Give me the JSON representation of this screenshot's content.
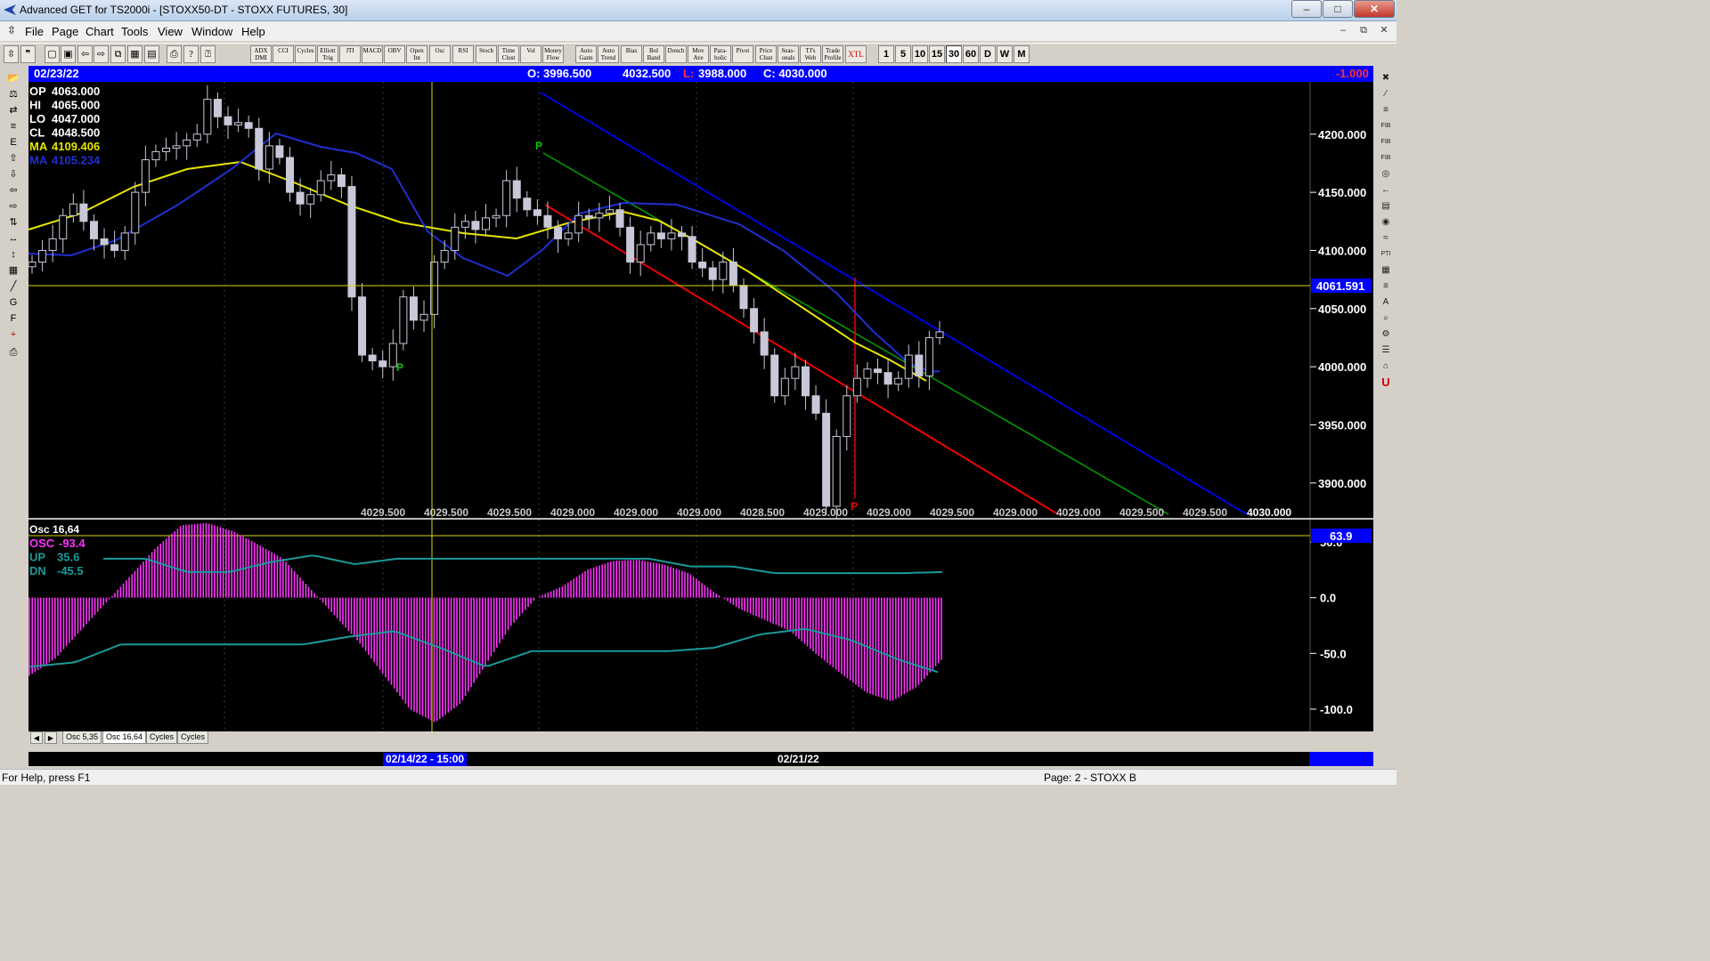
{
  "window": {
    "title": "Advanced GET for TS2000i - [STOXX50-DT - STOXX FUTURES, 30]",
    "buttons": [
      "–",
      "□",
      "✕"
    ]
  },
  "menu": [
    "File",
    "Page",
    "Chart",
    "Tools",
    "View",
    "Window",
    "Help"
  ],
  "mdi_buttons": [
    "–",
    "⧉",
    "✕"
  ],
  "toolbar": {
    "indicators": [
      "ADX DMI",
      "CCI",
      "Cycles",
      "Elliott Trig",
      "JTI",
      "MACD",
      "OBV",
      "Open Int",
      "Osc",
      "RSI",
      "Stoch",
      "Time Clust",
      "Vol",
      "Money Flow",
      "Auto Gann",
      "Auto Trend",
      "Bias",
      "Bol Band",
      "Donch",
      "Mov Ave",
      "Para-bolic",
      "Pivot",
      "Price Clust",
      "Seas-onals",
      "TJ's Web",
      "Trade Profile",
      "XTL"
    ],
    "timeframes": [
      "1",
      "5",
      "10",
      "15",
      "30",
      "60",
      "D",
      "W",
      "M"
    ],
    "active_timeframe": "30"
  },
  "left_tools": [
    "📂",
    "⚖",
    "⇄",
    "≡",
    "E",
    "⇧",
    "⇩",
    "⇦",
    "⇨",
    "⇅",
    "↔",
    "↕",
    "▦",
    "╱",
    "G",
    "F",
    "+",
    "⎙"
  ],
  "right_tools": [
    "✖",
    "∕",
    "≡",
    "FIB",
    "FIB",
    "FIB",
    "◎",
    "←",
    "▤",
    "◉",
    "≈",
    "PTI",
    "▦",
    "≡",
    "A",
    "⌕",
    "⚙",
    "☰",
    "⌂",
    "U"
  ],
  "info": {
    "date": "02/23/22",
    "open": "O: 3996.500",
    "high": "4032.500",
    "low_label": "L:",
    "low": "3988.000",
    "close": "C: 4030.000",
    "change": "-1.000"
  },
  "legend": {
    "op_label": "OP",
    "op": "4063.000",
    "hi_label": "HI",
    "hi": "4065.000",
    "lo_label": "LO",
    "lo": "4047.000",
    "cl_label": "CL",
    "cl": "4048.500",
    "ma1_label": "MA",
    "ma1": "4109.406",
    "ma2_label": "MA",
    "ma2": "4105.234"
  },
  "colors": {
    "background": "#000000",
    "bars": "#c8c8d8",
    "ma1": "#e6e600",
    "ma2": "#1f2fd0",
    "channel_top": "#0000dd",
    "channel_mid": "#00a000",
    "channel_bottom": "#ee0000",
    "osc": "#ff33ff",
    "bands": "#1a9a9a",
    "crosshair": "#d8d800",
    "accent": "#0000ff"
  },
  "chart_data": [
    {
      "type": "candlestick",
      "title": "STOXX50-DT - STOXX FUTURES, 30",
      "y_ticks": [
        "4200.000",
        "4150.000",
        "4100.000",
        "4050.000",
        "4000.000",
        "3950.000",
        "3900.000"
      ],
      "ylim": [
        3870,
        4245
      ],
      "cursor_price": "4061.591",
      "bottom_labels": [
        "4029.500",
        "4029.500",
        "4029.500",
        "4029.000",
        "4029.000",
        "4029.000",
        "4028.500",
        "4029.000",
        "4029.000",
        "4029.500",
        "4029.000",
        "4029.000",
        "4029.500",
        "4029.500"
      ],
      "last_price": "4030.000",
      "pivot_label": "P",
      "x_dates": [
        "02/14/22 - 15:00",
        "02/21/22"
      ],
      "closes": [
        4090,
        4100,
        4110,
        4130,
        4140,
        4125,
        4110,
        4105,
        4100,
        4115,
        4150,
        4178,
        4185,
        4188,
        4190,
        4195,
        4200,
        4230,
        4215,
        4208,
        4210,
        4205,
        4170,
        4190,
        4180,
        4150,
        4140,
        4148,
        4160,
        4165,
        4155,
        4060,
        4010,
        4005,
        4000,
        4020,
        4060,
        4040,
        4045,
        4090,
        4100,
        4120,
        4125,
        4118,
        4128,
        4130,
        4160,
        4145,
        4135,
        4130,
        4120,
        4110,
        4115,
        4130,
        4128,
        4132,
        4135,
        4120,
        4090,
        4105,
        4115,
        4110,
        4115,
        4112,
        4090,
        4085,
        4075,
        4090,
        4070,
        4050,
        4030,
        4010,
        3975,
        3990,
        4000,
        3975,
        3960,
        3880,
        3940,
        3975,
        3990,
        3998,
        3995,
        3985,
        3990,
        4010,
        3992,
        4025,
        4030
      ]
    },
    {
      "type": "bar",
      "title": "Osc 16,64",
      "series": [
        {
          "name": "OSC",
          "label": "OSC",
          "value": "-93.4"
        },
        {
          "name": "UP",
          "label": "UP",
          "value": "35.6"
        },
        {
          "name": "DN",
          "label": "DN",
          "value": "-45.5"
        }
      ],
      "y_ticks": [
        "50.0",
        "0.0",
        "-50.0",
        "-100.0"
      ],
      "ylim": [
        -120,
        70
      ],
      "cursor_value": "63.9",
      "values": [
        -70,
        -55,
        -30,
        -5,
        20,
        45,
        65,
        67,
        60,
        48,
        35,
        10,
        -15,
        -40,
        -70,
        -100,
        -112,
        -95,
        -60,
        -25,
        0,
        10,
        25,
        33,
        34,
        30,
        22,
        5,
        -10,
        -20,
        -30,
        -50,
        -68,
        -85,
        -93,
        -80,
        -55
      ],
      "up": [
        35,
        35,
        23,
        23,
        32,
        38,
        30,
        35,
        35,
        35,
        35,
        35,
        35,
        35,
        28,
        28,
        22,
        22,
        22,
        22,
        23
      ],
      "dn": [
        -62,
        -58,
        -42,
        -42,
        -42,
        -42,
        -42,
        -35,
        -30,
        -45,
        -62,
        -48,
        -48,
        -48,
        -48,
        -45,
        -33,
        -28,
        -38,
        -55,
        -68
      ]
    }
  ],
  "tabs": [
    "Osc 5,35",
    "Osc 16,64",
    "Cycles",
    "Cycles"
  ],
  "tab_nav": [
    "◀",
    "▶"
  ],
  "status": {
    "help": "For Help, press F1",
    "page": "Page: 2 - STOXX B"
  }
}
